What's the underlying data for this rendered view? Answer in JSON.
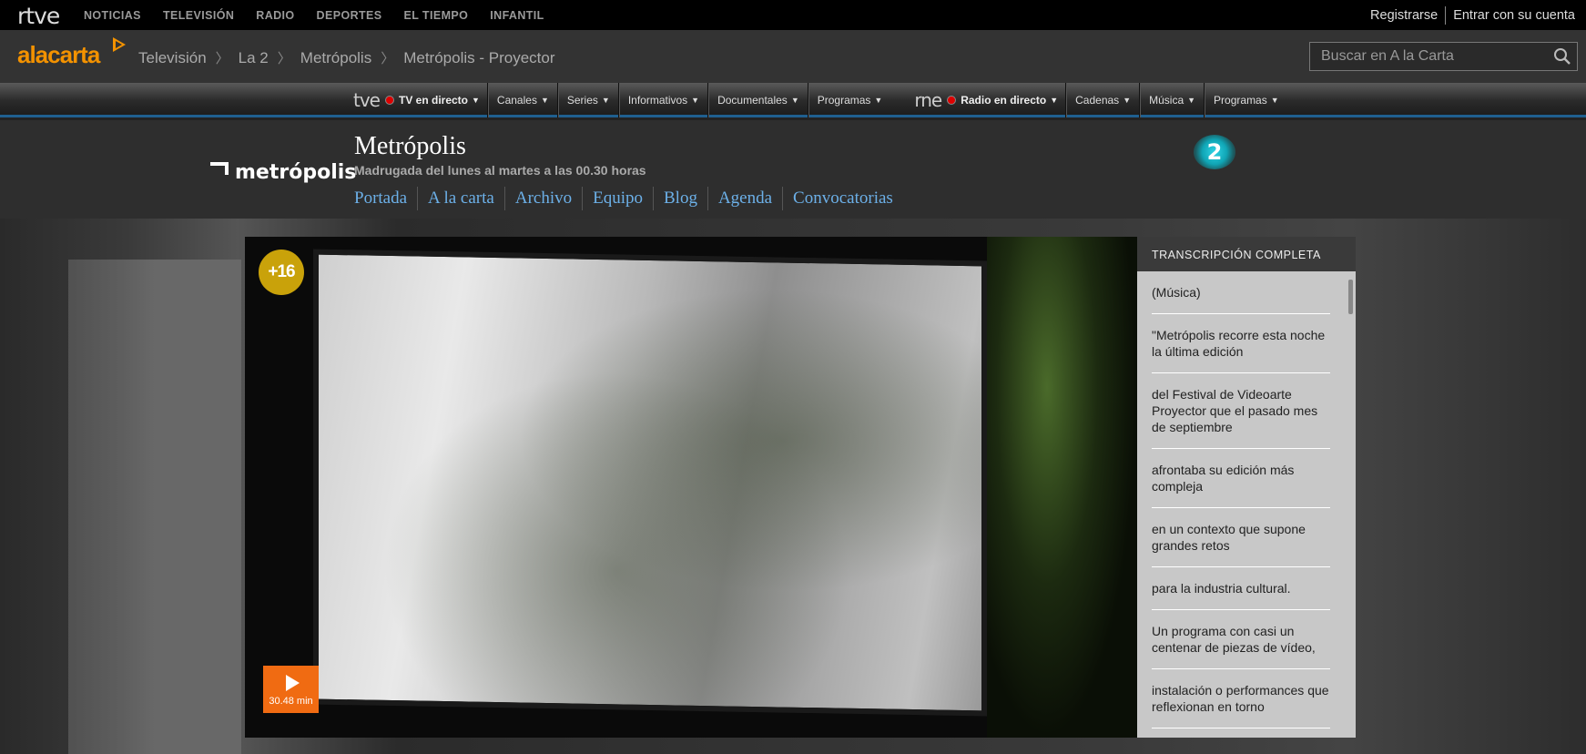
{
  "topbar": {
    "logo": "rtve",
    "nav": [
      "NOTICIAS",
      "TELEVISIÓN",
      "RADIO",
      "DEPORTES",
      "EL TIEMPO",
      "INFANTIL"
    ],
    "register": "Registrarse",
    "login": "Entrar con su cuenta"
  },
  "alacarta": {
    "logo": "alacarta",
    "breadcrumbs": [
      "Televisión",
      "La 2",
      "Metrópolis",
      "Metrópolis - Proyector"
    ],
    "search_placeholder": "Buscar en A la Carta"
  },
  "menubar": {
    "tve_brand": "tve",
    "tve_live": "TV en directo",
    "tve_items": [
      "Canales",
      "Series",
      "Informativos",
      "Documentales",
      "Programas"
    ],
    "rne_brand": "rne",
    "rne_live": "Radio en directo",
    "rne_items": [
      "Cadenas",
      "Música",
      "Programas"
    ]
  },
  "program": {
    "logo_text": "metrópolis",
    "title": "Metrópolis",
    "schedule": "Madrugada del lunes al martes a las 00.30 horas",
    "nav": [
      "Portada",
      "A la carta",
      "Archivo",
      "Equipo",
      "Blog",
      "Agenda",
      "Convocatorias"
    ],
    "channel_badge": "2"
  },
  "player": {
    "age_rating": "+16",
    "duration": "30.48 min"
  },
  "transcript": {
    "heading": "TRANSCRIPCIÓN COMPLETA",
    "lines": [
      "(Música)",
      "\"Metrópolis recorre esta noche la última edición",
      "del Festival de Videoarte Proyector que el pasado mes de septiembre",
      "afrontaba su edición más compleja",
      "en un contexto que supone grandes retos",
      "para la industria cultural.",
      "Un programa con casi un centenar de piezas de vídeo,",
      "instalación o performances que reflexionan en torno"
    ]
  },
  "colors": {
    "accent_orange": "#f39200",
    "link_blue": "#6cb0e8",
    "live_red": "#dd0000"
  }
}
